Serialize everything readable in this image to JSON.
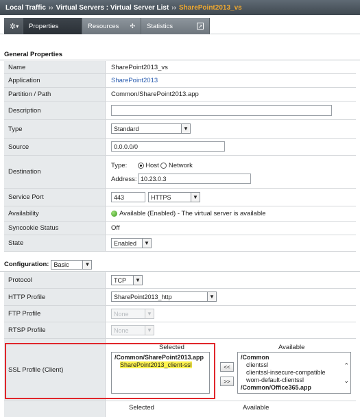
{
  "breadcrumb": {
    "part1": "Local Traffic",
    "part2": "Virtual Servers : Virtual Server List",
    "current": "SharePoint2013_vs",
    "separator": "››"
  },
  "tabs": {
    "gear_caret": "▾",
    "properties": "Properties",
    "resources": "Resources",
    "statistics": "Statistics"
  },
  "general": {
    "header": "General Properties",
    "rows": {
      "name": {
        "label": "Name",
        "value": "SharePoint2013_vs"
      },
      "application": {
        "label": "Application",
        "value": "SharePoint2013"
      },
      "partition": {
        "label": "Partition / Path",
        "value": "Common/SharePoint2013.app"
      },
      "description": {
        "label": "Description",
        "value": ""
      },
      "type": {
        "label": "Type",
        "value": "Standard"
      },
      "source": {
        "label": "Source",
        "value": "0.0.0.0/0"
      },
      "destination": {
        "label": "Destination",
        "type_label": "Type:",
        "host_label": "Host",
        "network_label": "Network",
        "address_label": "Address:",
        "address_value": "10.23.0.3"
      },
      "service_port": {
        "label": "Service Port",
        "port": "443",
        "protocol": "HTTPS"
      },
      "availability": {
        "label": "Availability",
        "value": "Available (Enabled) - The virtual server is available"
      },
      "syncookie": {
        "label": "Syncookie Status",
        "value": "Off"
      },
      "state": {
        "label": "State",
        "value": "Enabled"
      }
    }
  },
  "configuration": {
    "header": "Configuration:",
    "mode": "Basic",
    "rows": {
      "protocol": {
        "label": "Protocol",
        "value": "TCP"
      },
      "http_profile": {
        "label": "HTTP Profile",
        "value": "SharePoint2013_http"
      },
      "ftp_profile": {
        "label": "FTP Profile",
        "value": "None"
      },
      "rtsp_profile": {
        "label": "RTSP Profile",
        "value": "None"
      },
      "ssl_client": {
        "label": "SSL Profile (Client)",
        "selected_header": "Selected",
        "available_header": "Available",
        "selected_items": [
          "/Common/SharePoint2013.app",
          "SharePoint2013_client-ssl"
        ],
        "available_items": [
          "/Common",
          "clientssl",
          "clientssl-insecure-compatible",
          "wom-default-clientssl",
          "/Common/Office365.app"
        ],
        "move_left": "<<",
        "move_right": ">>"
      }
    },
    "next_selected_header": "Selected",
    "next_available_header": "Available"
  },
  "colors": {
    "accent_current": "#f0a930",
    "link": "#2a5db0",
    "annotation_box": "#e0262b",
    "highlight": "#fff34d"
  }
}
